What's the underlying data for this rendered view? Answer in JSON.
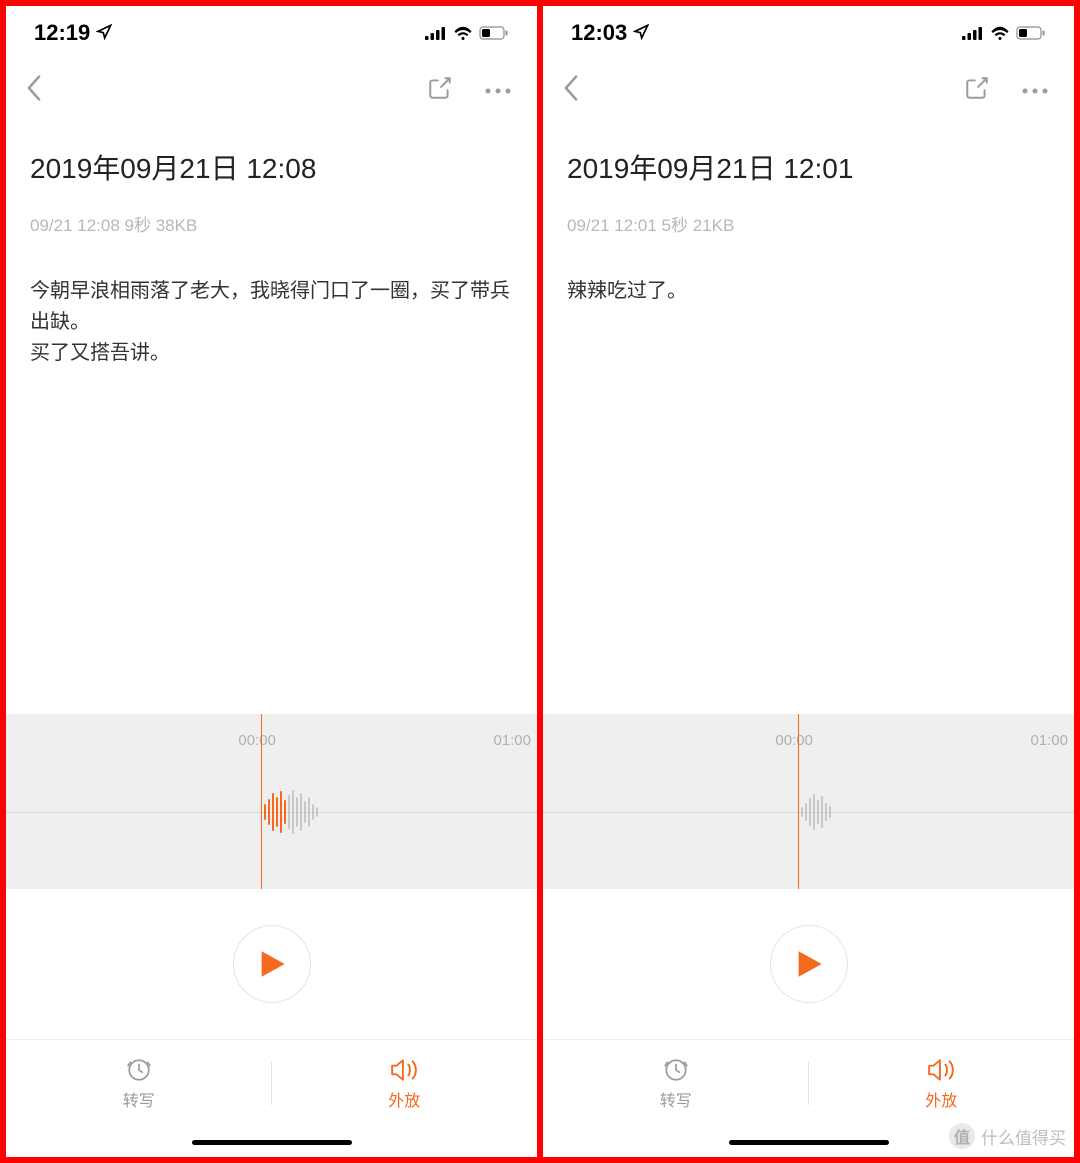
{
  "watermark": {
    "badge": "值",
    "text": "什么值得买"
  },
  "screens": [
    {
      "status": {
        "time": "12:19"
      },
      "title": "2019年09月21日 12:08",
      "subtitle": "09/21 12:08 9秒 38KB",
      "transcript": "今朝早浪相雨落了老大，我晓得门口了一圈，买了带兵出缺。\n买了又搭吾讲。",
      "timeline": {
        "start": "00:00",
        "end": "01:00"
      },
      "waveform_colored": true,
      "tabs": {
        "transcribe": "转写",
        "speaker": "外放"
      }
    },
    {
      "status": {
        "time": "12:03"
      },
      "title": "2019年09月21日 12:01",
      "subtitle": "09/21 12:01 5秒 21KB",
      "transcript": "辣辣吃过了。",
      "timeline": {
        "start": "00:00",
        "end": "01:00"
      },
      "waveform_colored": false,
      "tabs": {
        "transcribe": "转写",
        "speaker": "外放"
      }
    }
  ]
}
